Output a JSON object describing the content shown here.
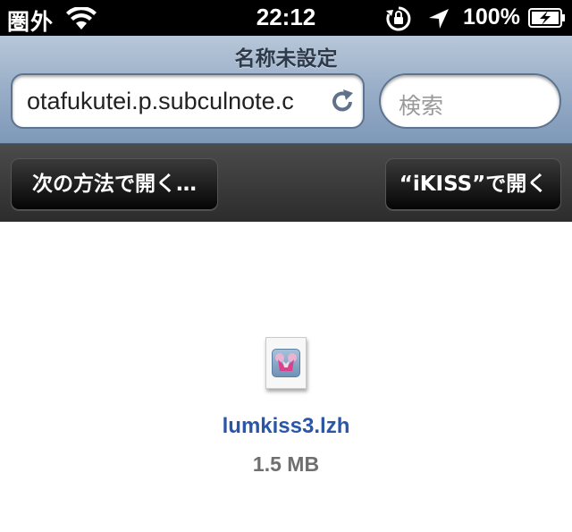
{
  "status_bar": {
    "carrier": "圏外",
    "time": "22:12",
    "battery": "100%",
    "icons": [
      "wifi-icon",
      "rotation-lock-icon",
      "location-arrow-icon",
      "battery-charging-icon"
    ]
  },
  "header": {
    "title": "名称未設定",
    "url": "otafukutei.p.subculnote.c",
    "search_placeholder": "検索"
  },
  "download_bar": {
    "open_with_label": "次の方法で開く…",
    "open_in_app_label": "“iKISS”で開く"
  },
  "file": {
    "name": "lumkiss3.lzh",
    "size": "1.5 MB",
    "icon": "lzh-archive-file-icon"
  },
  "colors": {
    "status_bar_bg": "#000000",
    "header_bg": "#9bb0c9",
    "toolbar_bg": "#3a3a3a",
    "file_name_link": "#2b56a8",
    "file_size_text": "#6f6f6f"
  }
}
